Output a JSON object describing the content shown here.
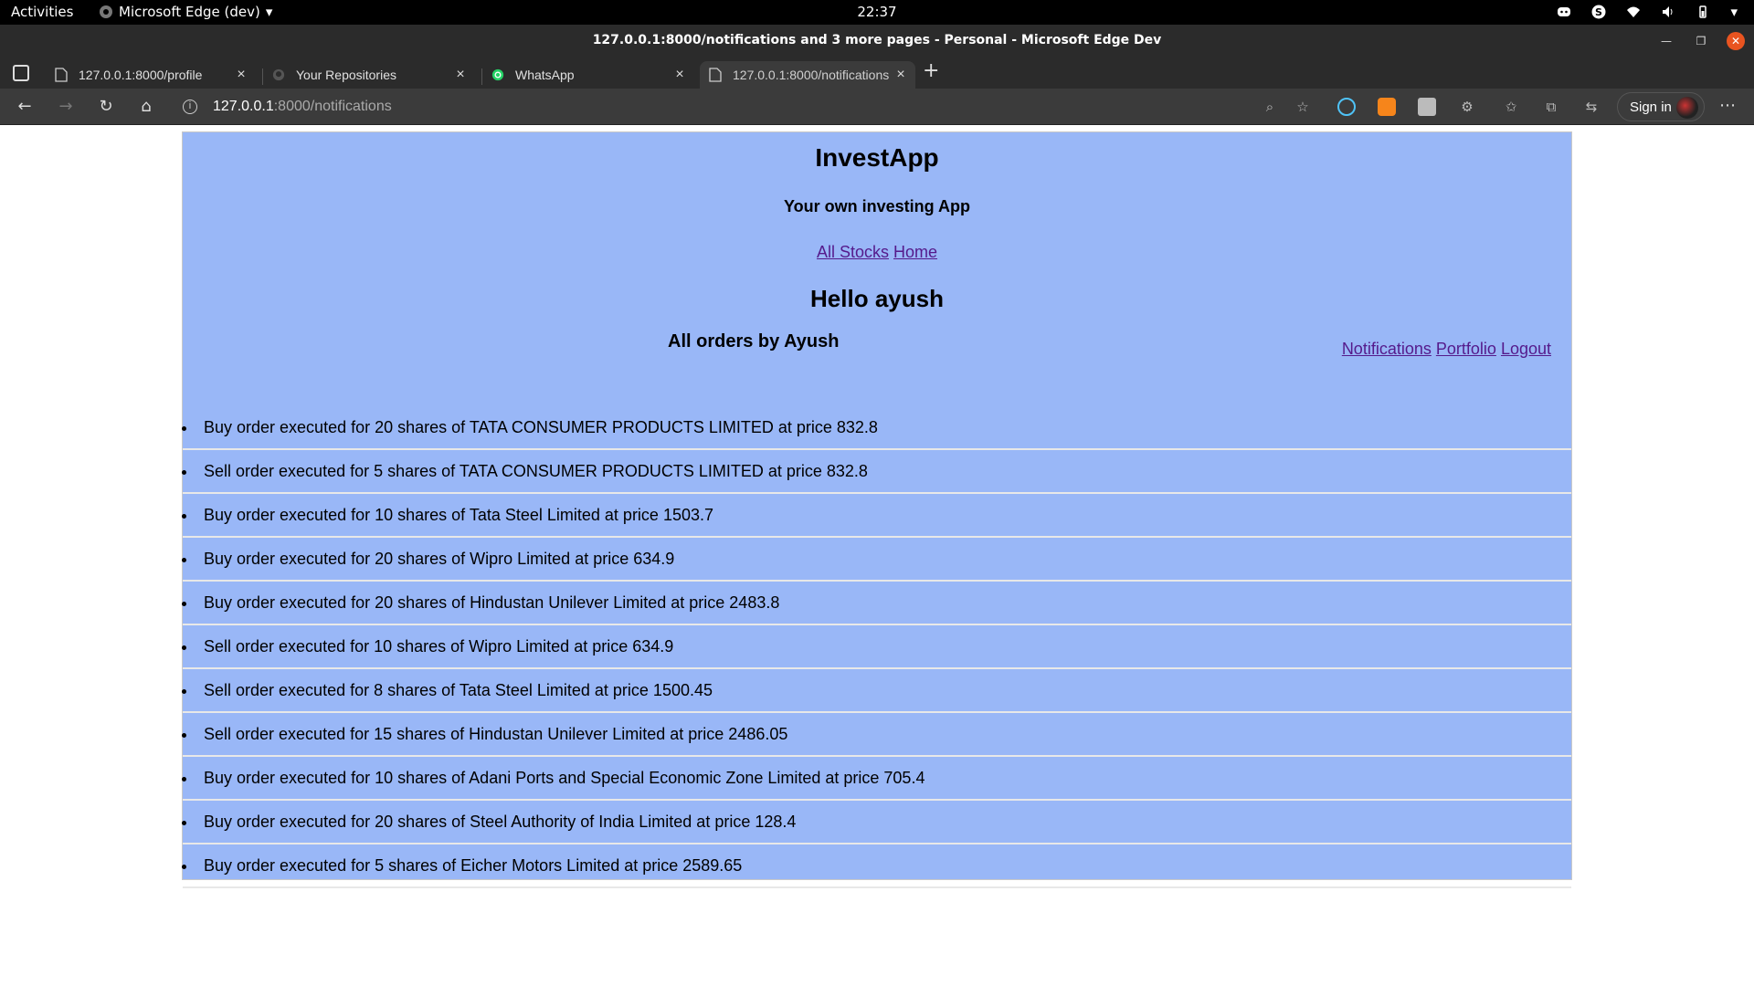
{
  "system": {
    "activities": "Activities",
    "app_name": "Microsoft Edge (dev)",
    "time": "22:37"
  },
  "window": {
    "title": "127.0.0.1:8000/notifications and 3 more pages - Personal - Microsoft Edge Dev"
  },
  "tabs": [
    {
      "label": "127.0.0.1:8000/profile",
      "favicon": "page-icon"
    },
    {
      "label": "Your Repositories",
      "favicon": "github-icon"
    },
    {
      "label": "WhatsApp",
      "favicon": "whatsapp-icon"
    },
    {
      "label": "127.0.0.1:8000/notifications",
      "favicon": "page-icon",
      "active": true
    }
  ],
  "address": {
    "host": "127.0.0.1",
    "path": ":8000/notifications"
  },
  "toolbar": {
    "sign_in": "Sign in"
  },
  "page": {
    "brand": "InvestApp",
    "tagline": "Your own investing App",
    "nav": [
      "All Stocks",
      "Home"
    ],
    "greeting": "Hello ayush",
    "orders_title": "All orders by Ayush",
    "right_links": [
      "Notifications",
      "Portfolio",
      "Logout"
    ],
    "orders": [
      "Buy order executed for 20 shares of TATA CONSUMER PRODUCTS LIMITED at price 832.8",
      "Sell order executed for 5 shares of TATA CONSUMER PRODUCTS LIMITED at price 832.8",
      "Buy order executed for 10 shares of Tata Steel Limited at price 1503.7",
      "Buy order executed for 20 shares of Wipro Limited at price 634.9",
      "Buy order executed for 20 shares of Hindustan Unilever Limited at price 2483.8",
      "Sell order executed for 10 shares of Wipro Limited at price 634.9",
      "Sell order executed for 8 shares of Tata Steel Limited at price 1500.45",
      "Sell order executed for 15 shares of Hindustan Unilever Limited at price 2486.05",
      "Buy order executed for 10 shares of Adani Ports and Special Economic Zone Limited at price 705.4",
      "Buy order executed for 20 shares of Steel Authority of India Limited at price 128.4",
      "Buy order executed for 5 shares of Eicher Motors Limited at price 2589.65"
    ]
  }
}
